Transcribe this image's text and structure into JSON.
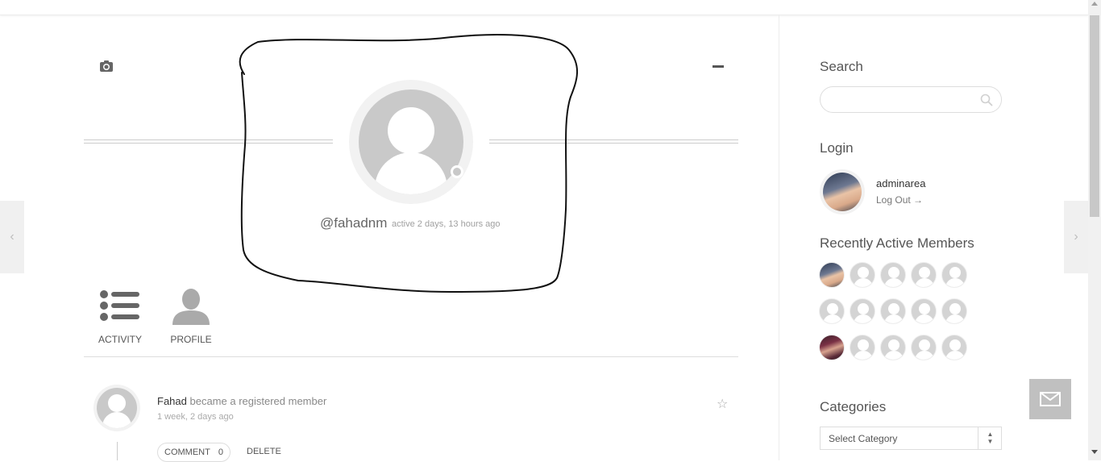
{
  "profile": {
    "handle": "@fahadnm",
    "active": "active 2 days, 13 hours ago"
  },
  "tabs": [
    {
      "label": "ACTIVITY",
      "icon": "activity-list-icon"
    },
    {
      "label": "PROFILE",
      "icon": "profile-person-icon"
    }
  ],
  "activity": {
    "user": "Fahad",
    "action": " became a registered member",
    "time": "1 week, 2 days ago",
    "comment_label": "COMMENT",
    "comment_count": "0",
    "delete_label": "DELETE"
  },
  "sidebar": {
    "search_title": "Search",
    "search_placeholder": "",
    "login_title": "Login",
    "login_name": "adminarea",
    "logout_label": "Log Out →",
    "members_title": "Recently Active Members",
    "categories_title": "Categories",
    "category_selected": "Select Category"
  },
  "icons": {
    "camera": "camera-icon",
    "minimize": "minimize-icon",
    "star": "star-icon",
    "search": "search-icon",
    "mail": "mail-icon",
    "prev": "chevron-left-icon",
    "next": "chevron-right-icon"
  },
  "colors": {
    "avatar_placeholder": "#c9c9c9",
    "fab": "#c0c0c0"
  }
}
